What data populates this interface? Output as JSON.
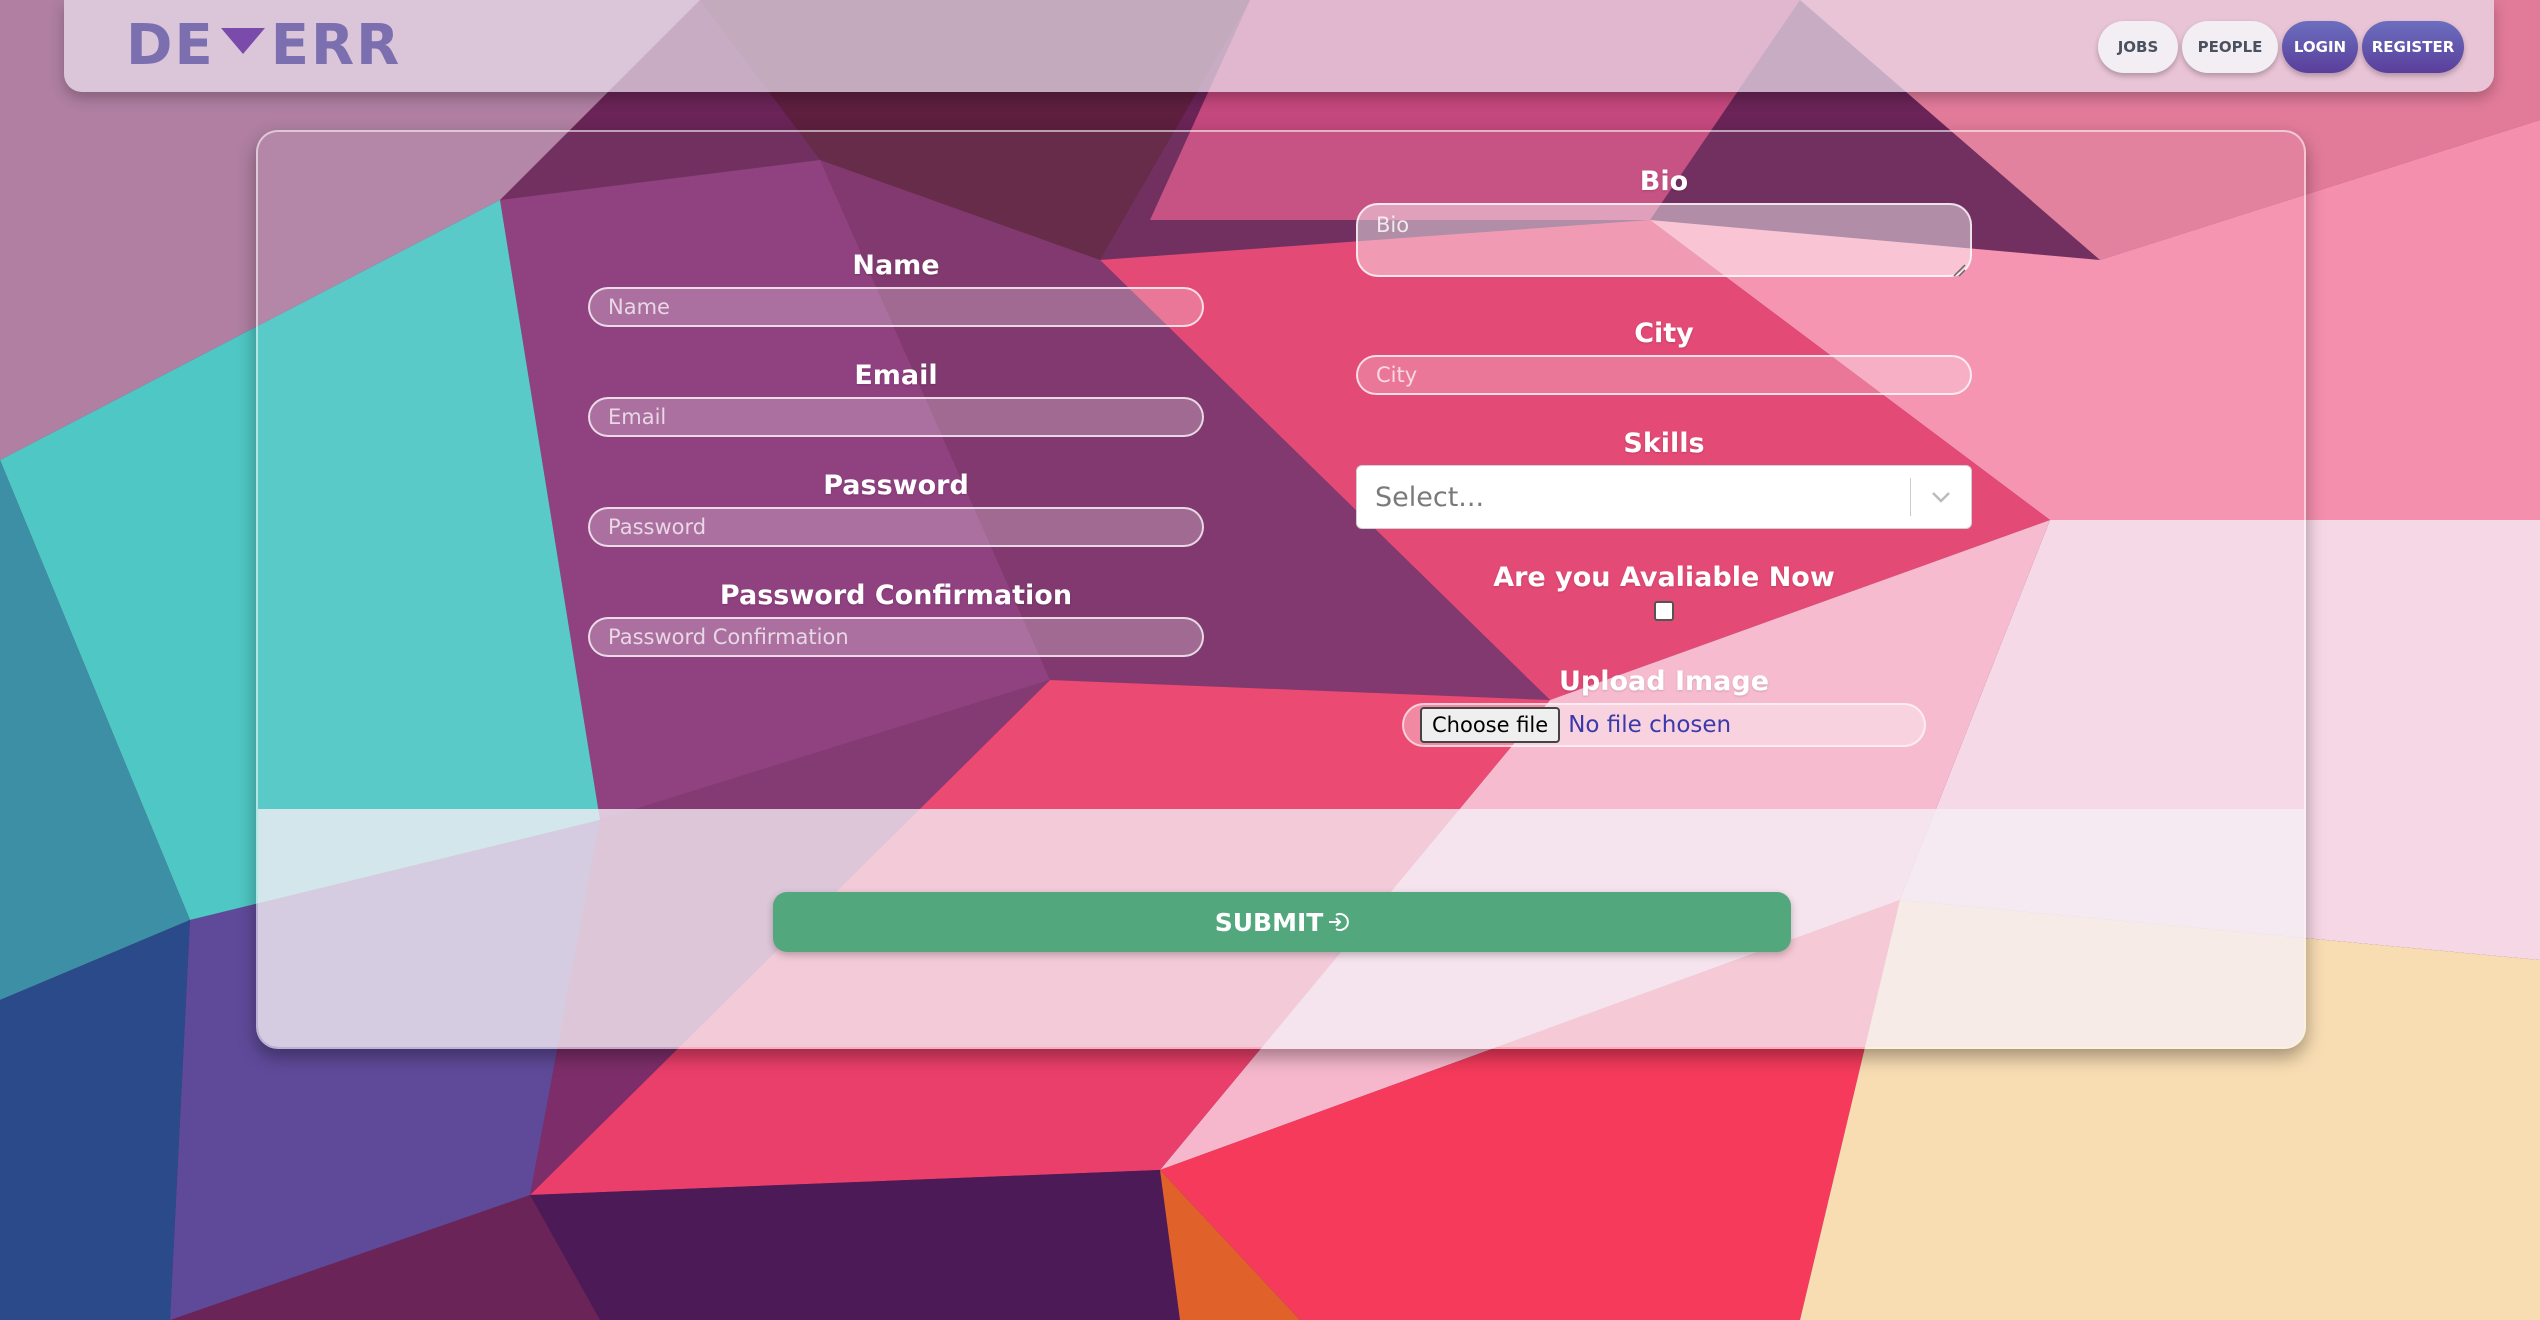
{
  "brand": {
    "logo_left": "DE",
    "logo_right": "ERR"
  },
  "nav": {
    "jobs": "JOBS",
    "people": "PEOPLE",
    "login": "LOGIN",
    "register": "REGISTER"
  },
  "form": {
    "name": {
      "label": "Name",
      "placeholder": "Name"
    },
    "email": {
      "label": "Email",
      "placeholder": "Email"
    },
    "password": {
      "label": "Password",
      "placeholder": "Password"
    },
    "password_confirmation": {
      "label": "Password Confirmation",
      "placeholder": "Password Confirmation"
    },
    "bio": {
      "label": "Bio",
      "placeholder": "Bio"
    },
    "city": {
      "label": "City",
      "placeholder": "City"
    },
    "skills": {
      "label": "Skills",
      "placeholder": "Select..."
    },
    "available": {
      "label": "Are you Avaliable Now",
      "checked": false
    },
    "upload": {
      "label": "Upload Image",
      "button": "Choose file",
      "status": "No file chosen"
    },
    "submit": "SUBMIT"
  },
  "colors": {
    "submit": "#52a77c",
    "nav_dark": "#5a3e9b",
    "logo": "#7c6fb0"
  }
}
